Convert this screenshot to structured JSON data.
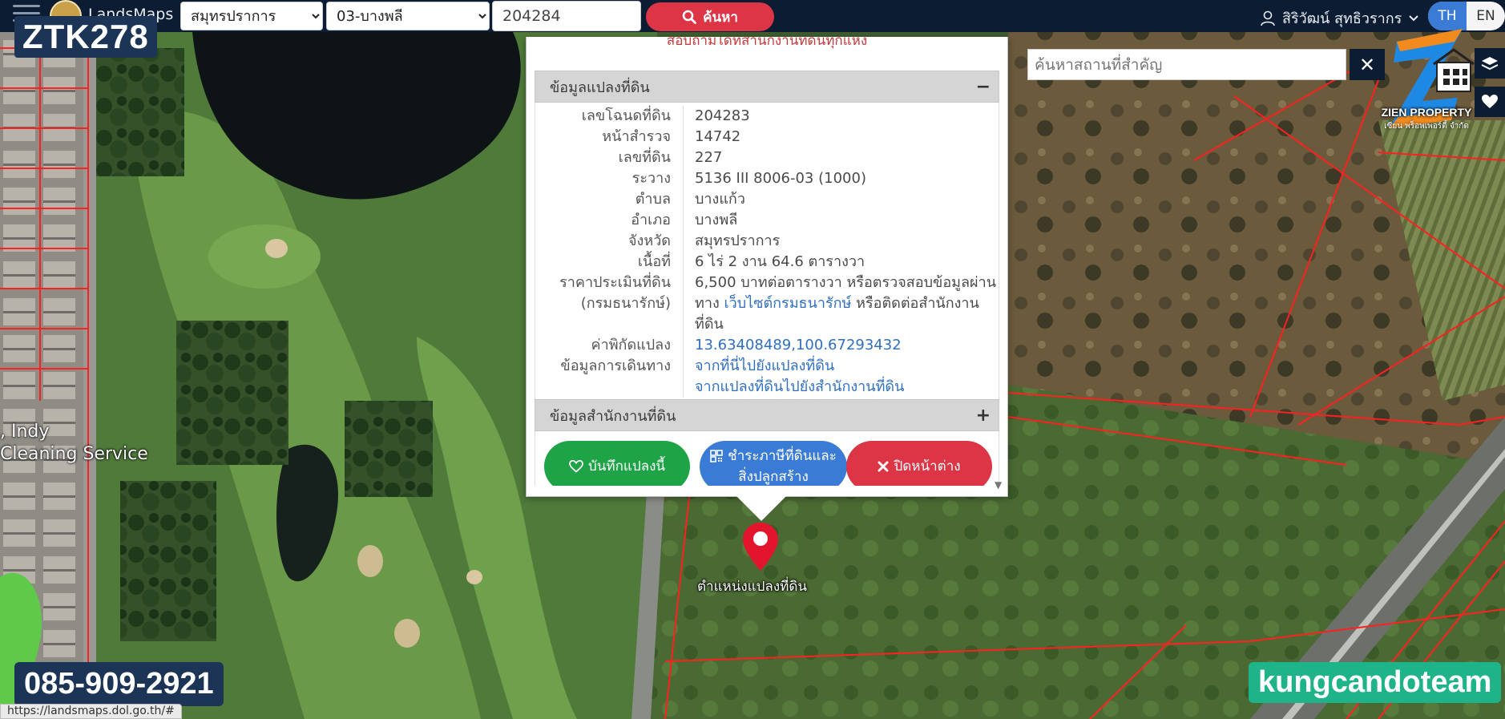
{
  "navbar": {
    "app_name": "LandsMaps",
    "province_selected": "สมุทรปราการ",
    "district_selected": "03-บางพลี",
    "parcel_input_value": "204284",
    "search_label": "ค้นหา",
    "user_name": "สิริวัฒน์ สุทธิวรากร",
    "lang_th": "TH",
    "lang_en": "EN"
  },
  "watermarks": {
    "code": "ZTK278",
    "phone": "085-909-2921",
    "team": "kungcandoteam",
    "zien_name": "ZIEN PROPERTY",
    "zien_sub": "เซียน พร็อพเพอร์ตี้ จำกัด"
  },
  "place_search": {
    "placeholder": "ค้นหาสถานที่สำคัญ",
    "close_symbol": "✕"
  },
  "popup": {
    "notice": "สอบถามได้ที่สำนักงานที่ดินทุกแห่ง",
    "section_parcel_title": "ข้อมูลแปลงที่ดิน",
    "section_parcel_toggle": "−",
    "rows": [
      {
        "label": "เลขโฉนดที่ดิน",
        "value": "204283"
      },
      {
        "label": "หน้าสำรวจ",
        "value": "14742"
      },
      {
        "label": "เลขที่ดิน",
        "value": "227"
      },
      {
        "label": "ระวาง",
        "value": "5136 III 8006-03 (1000)"
      },
      {
        "label": "ตำบล",
        "value": "บางแก้ว"
      },
      {
        "label": "อำเภอ",
        "value": "บางพลี"
      },
      {
        "label": "จังหวัด",
        "value": "สมุทรปราการ"
      },
      {
        "label": "เนื้อที่",
        "value": "6 ไร่ 2 งาน 64.6 ตารางวา"
      }
    ],
    "price": {
      "label_line1": "ราคาประเมินที่ดิน",
      "label_line2": "(กรมธนารักษ์)",
      "value_line1": "6,500 บาทต่อตารางวา หรือตรวจสอบข้อมูลผ่าน",
      "value_pre": "ทาง ",
      "value_link": "เว็บไซต์กรมธนารักษ์",
      "value_post": " หรือติดต่อสำนักงานที่ดิน"
    },
    "coords": {
      "label": "ค่าพิกัดแปลง",
      "value": "13.63408489,100.67293432"
    },
    "travel": {
      "label": "ข้อมูลการเดินทาง",
      "link1": "จากที่นี่ไปยังแปลงที่ดิน",
      "link2": "จากแปลงที่ดินไปยังสำนักงานที่ดิน"
    },
    "section_office_title": "ข้อมูลสำนักงานที่ดิน",
    "section_office_toggle": "+",
    "btn_save": "บันทึกแปลงนี้",
    "btn_tax_line1": "ชำระภาษีที่ดินและ",
    "btn_tax_line2": "สิ่งปลูกสร้าง",
    "btn_close": "ปิดหน้าต่าง"
  },
  "map": {
    "marker_label": "ตำแหน่งแปลงที่ดิน",
    "poi_label_1": ", Indy",
    "poi_label_2": "Cleaning Service"
  },
  "status_url": "https://landsmaps.dol.go.th/#",
  "colors": {
    "navbar": "#0b1c33",
    "danger": "#dc3545",
    "success": "#1fa347",
    "primary": "#3a7bd5",
    "link": "#2f6fc1",
    "parcel_line": "#ff2020"
  }
}
